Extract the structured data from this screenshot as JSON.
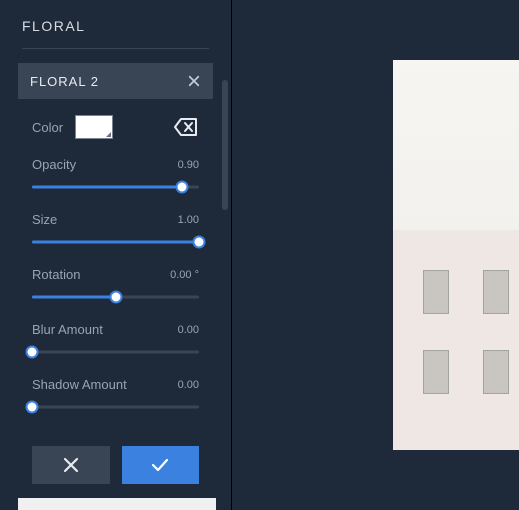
{
  "section": {
    "title": "FLORAL"
  },
  "panel": {
    "title": "FLORAL 2",
    "color": {
      "label": "Color",
      "value": "#FFFFFF"
    },
    "opacity": {
      "label": "Opacity",
      "value": "0.90",
      "pct": 90
    },
    "size": {
      "label": "Size",
      "value": "1.00",
      "pct": 100
    },
    "rotation": {
      "label": "Rotation",
      "value": "0.00 °",
      "pct": 50
    },
    "blur": {
      "label": "Blur Amount",
      "value": "0.00",
      "pct": 0
    },
    "shadow": {
      "label": "Shadow Amount",
      "value": "0.00",
      "pct": 0
    }
  }
}
